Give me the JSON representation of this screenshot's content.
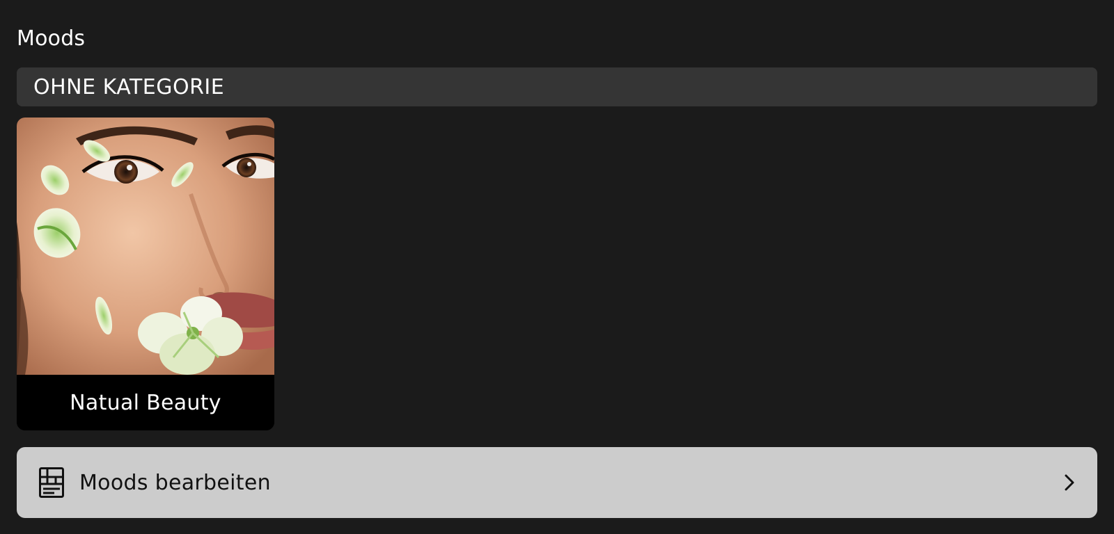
{
  "header": {
    "title": "Moods"
  },
  "category": {
    "label": "OHNE KATEGORIE"
  },
  "moods": [
    {
      "label": "Natual Beauty",
      "image_icon": "face-with-petals-photo"
    }
  ],
  "edit_row": {
    "label": "Moods bearbeiten",
    "icon": "moodboard-grid-icon",
    "chevron_icon": "chevron-right-icon"
  },
  "colors": {
    "background": "#1b1b1b",
    "category_bar": "#353535",
    "edit_row": "#cccccc",
    "card_label_bg": "#000000"
  }
}
